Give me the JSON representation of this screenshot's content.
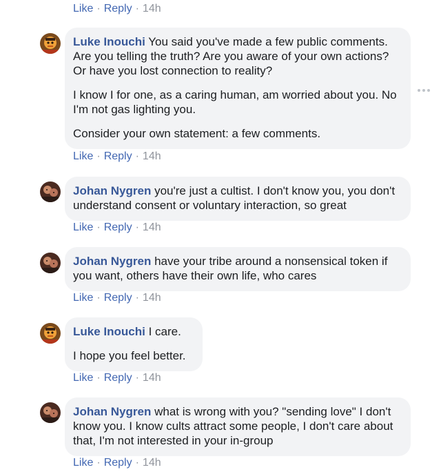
{
  "actions": {
    "like": "Like",
    "reply": "Reply",
    "time": "14h",
    "sep": "·"
  },
  "comments": [
    {
      "author": "Luke Inouchi",
      "paragraphs": [
        "You said you've made a few public comments. Are you telling the truth? Are you aware of your own actions? Or have you lost connection to reality?",
        "I know I for one, as a caring human, am worried about you. No I'm not gas lighting you.",
        "Consider your own statement: a few comments."
      ]
    },
    {
      "author": "Johan Nygren",
      "paragraphs": [
        "you're just a cultist. I don't know you, you don't understand consent or voluntary interaction, so great"
      ]
    },
    {
      "author": "Johan Nygren",
      "paragraphs": [
        "have your tribe around a nonsensical token if you want, others have their own life, who cares"
      ]
    },
    {
      "author": "Luke Inouchi",
      "paragraphs": [
        "I care.",
        "I hope you feel better."
      ]
    },
    {
      "author": "Johan Nygren",
      "paragraphs": [
        "what is wrong with you? \"sending love\" I don't know you. I know cults attract some people, I don't care about that, I'm not interested in your in-group"
      ]
    }
  ]
}
